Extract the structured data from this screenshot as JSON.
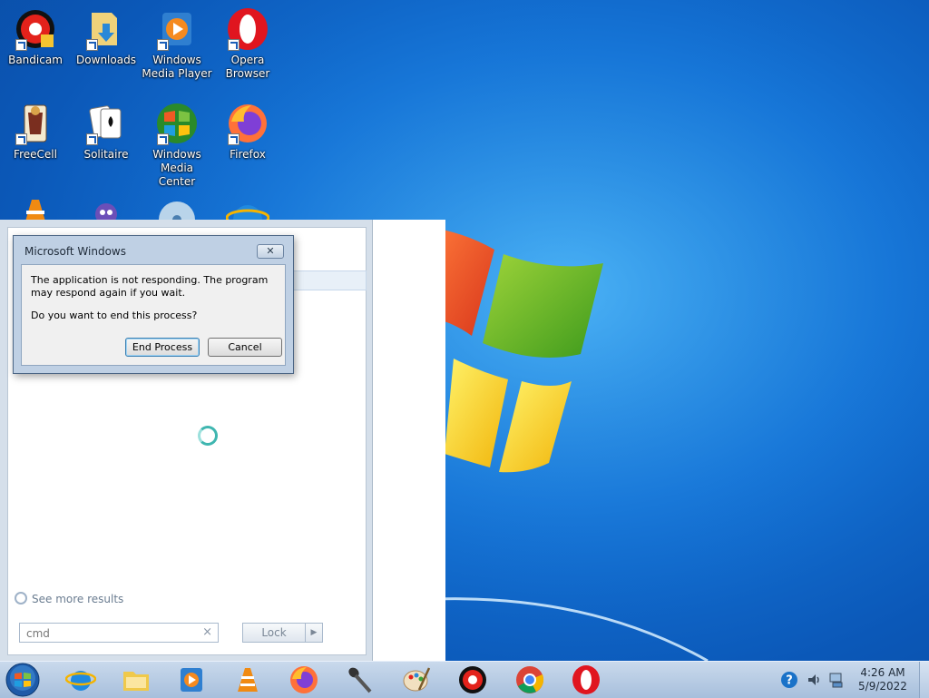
{
  "desktop": {
    "icons": [
      {
        "label": "Bandicam",
        "icon": "bandicam-icon"
      },
      {
        "label": "Downloads",
        "icon": "folder-download-icon"
      },
      {
        "label": "Windows Media Player",
        "icon": "media-player-icon"
      },
      {
        "label": "Opera Browser",
        "icon": "opera-icon"
      },
      {
        "label": "FreeCell",
        "icon": "freecell-icon"
      },
      {
        "label": "Solitaire",
        "icon": "solitaire-icon"
      },
      {
        "label": "Windows Media Center",
        "icon": "media-center-icon"
      },
      {
        "label": "Firefox",
        "icon": "firefox-icon"
      },
      {
        "label": "",
        "icon": "vlc-icon"
      },
      {
        "label": "",
        "icon": "purble-place-icon"
      },
      {
        "label": "",
        "icon": "dvd-maker-icon"
      },
      {
        "label": "",
        "icon": "internet-explorer-icon"
      }
    ]
  },
  "start_menu": {
    "see_more": "See more results",
    "search_value": "cmd",
    "search_clear": "×",
    "lock_label": "Lock",
    "lock_arrow": "▶"
  },
  "dialog": {
    "title": "Microsoft Windows",
    "close_label": "✕",
    "message_line1": "The application is not responding. The program may respond again if you wait.",
    "message_line2": "Do you want to end this process?",
    "end_process_label": "End Process",
    "cancel_label": "Cancel"
  },
  "taskbar": {
    "pinned": [
      "internet-explorer-icon",
      "file-explorer-icon",
      "media-player-icon",
      "vlc-icon",
      "firefox-icon",
      "microphone-icon",
      "paint-icon",
      "bandicam-icon",
      "chrome-icon",
      "opera-icon"
    ],
    "clock_time": "4:26 AM",
    "clock_date": "5/9/2022"
  },
  "colors": {
    "desktop_blue": "#1473d6",
    "dialog_frame": "#bfd0e4",
    "taskbar": "#b8cce4"
  }
}
